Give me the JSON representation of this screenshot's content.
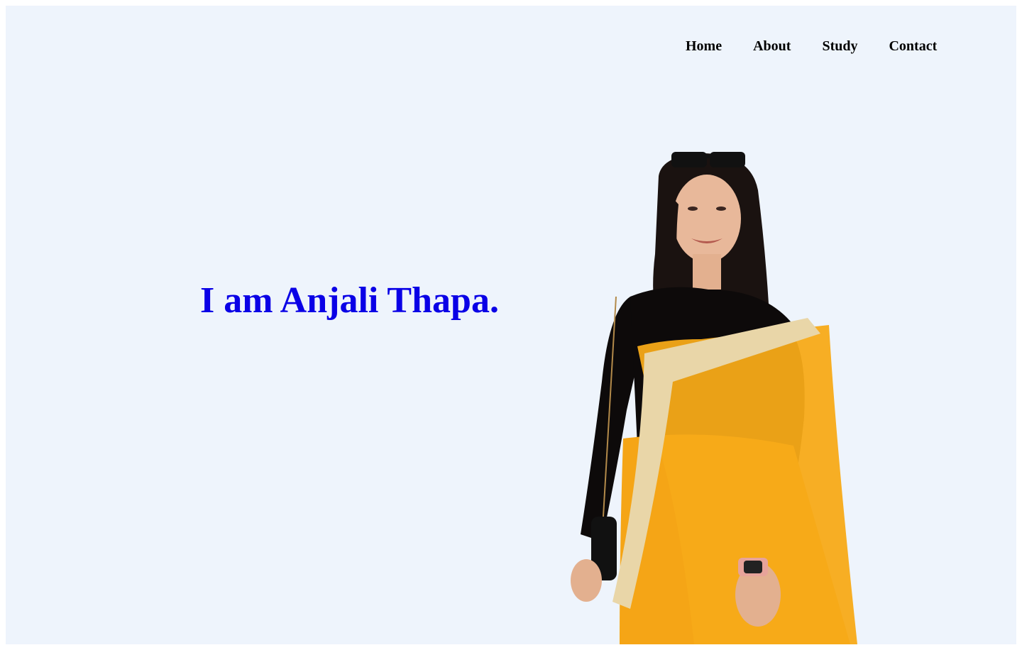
{
  "nav": {
    "items": [
      {
        "label": "Home"
      },
      {
        "label": "About"
      },
      {
        "label": "Study"
      },
      {
        "label": "Contact"
      }
    ]
  },
  "hero": {
    "title": "I am Anjali Thapa."
  },
  "colors": {
    "background": "#eef4fc",
    "title": "#0a00e6",
    "nav_text": "#000000",
    "saree": "#f5a516",
    "saree_border": "#e9d6a8",
    "blouse": "#0d0a0a"
  },
  "portrait": {
    "icon": "person-photo"
  }
}
